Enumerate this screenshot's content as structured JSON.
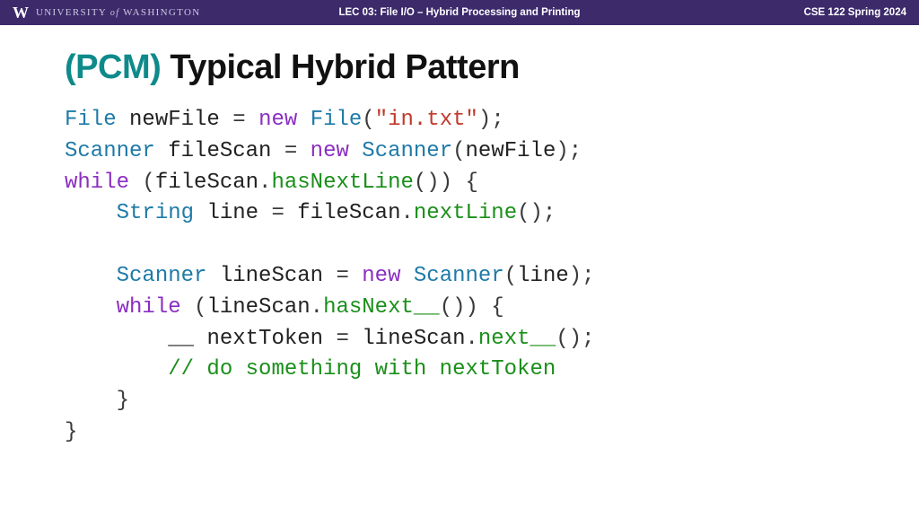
{
  "header": {
    "logo": "W",
    "university_pre": "UNIVERSITY",
    "university_of": "of",
    "university_post": "WASHINGTON",
    "center": "LEC 03: File I/O – Hybrid Processing and Printing",
    "right": "CSE 122 Spring 2024"
  },
  "title": {
    "prefix": "(PCM)",
    "rest": " Typical Hybrid Pattern"
  },
  "code": {
    "l1": {
      "t_file": "File",
      "sp1": " ",
      "v_newfile": "newFile",
      "eq": " = ",
      "kw_new": "new",
      "sp2": " ",
      "t_file2": "File",
      "lp": "(",
      "str": "\"in.txt\"",
      "rp": ");"
    },
    "l2": {
      "t_scanner": "Scanner",
      "sp1": " ",
      "v_filescan": "fileScan",
      "eq": " = ",
      "kw_new": "new",
      "sp2": " ",
      "t_scanner2": "Scanner",
      "lp": "(",
      "v_newfile": "newFile",
      "rp": ");"
    },
    "l3": {
      "kw_while": "while",
      "sp": " (",
      "v_filescan": "fileScan",
      "dot": ".",
      "m_hasnextline": "hasNextLine",
      "rp": "()) {"
    },
    "l4": {
      "indent": "    ",
      "t_string": "String",
      "sp": " ",
      "v_line": "line",
      "eq": " = ",
      "v_filescan": "fileScan",
      "dot": ".",
      "m_nextline": "nextLine",
      "rp": "();"
    },
    "l5": {
      "blank": ""
    },
    "l6": {
      "indent": "    ",
      "t_scanner": "Scanner",
      "sp": " ",
      "v_linescan": "lineScan",
      "eq": " = ",
      "kw_new": "new",
      "sp2": " ",
      "t_scanner2": "Scanner",
      "lp": "(",
      "v_line": "line",
      "rp": ");"
    },
    "l7": {
      "indent": "    ",
      "kw_while": "while",
      "sp": " (",
      "v_linescan": "lineScan",
      "dot": ".",
      "m_hasnext": "hasNext__",
      "rp": "()) {"
    },
    "l8": {
      "indent": "        ",
      "blank_type": "__",
      "sp": " ",
      "v_next": "nextToken",
      "eq": " = ",
      "v_linescan": "lineScan",
      "dot": ".",
      "m_next": "next__",
      "rp": "();"
    },
    "l9": {
      "indent": "        ",
      "comment": "// do something with nextToken"
    },
    "l10": {
      "indent": "    ",
      "brace": "}"
    },
    "l11": {
      "brace": "}"
    }
  }
}
